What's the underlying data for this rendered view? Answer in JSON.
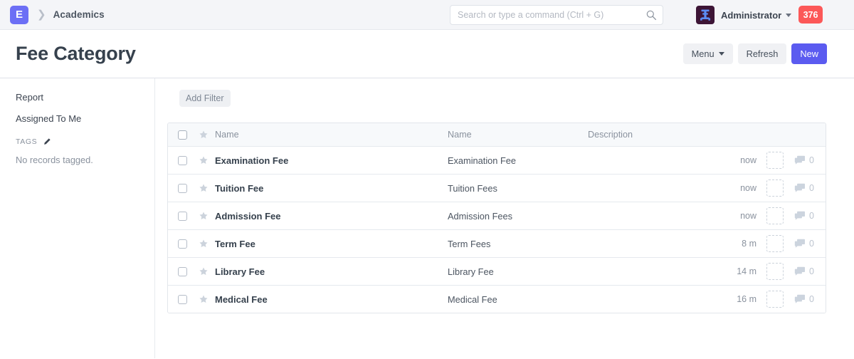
{
  "navbar": {
    "logo_letter": "E",
    "breadcrumb": "Academics",
    "separator_icon": "chevron-right-icon",
    "search": {
      "placeholder": "Search or type a command (Ctrl + G)",
      "value": "",
      "icon": "search-icon"
    },
    "user": {
      "name": "Administrator",
      "avatar_icon": "user-avatar-icon",
      "caret_icon": "chevron-down-icon"
    },
    "notification_badge": "376",
    "colors": {
      "logo_bg": "#6c6ff5",
      "badge_bg": "#fc5858",
      "navbar_bg": "#f4f5f8"
    }
  },
  "titlebar": {
    "title": "Fee Category",
    "buttons": {
      "menu": "Menu",
      "refresh": "Refresh",
      "new": "New"
    },
    "primary_color": "#5b5bf0"
  },
  "sidebar": {
    "links": [
      {
        "label": "Report"
      },
      {
        "label": "Assigned To Me"
      }
    ],
    "tags": {
      "heading": "TAGS",
      "edit_icon": "pencil-icon",
      "empty_text": "No records tagged."
    }
  },
  "content": {
    "filter": {
      "add_filter_label": "Add Filter"
    },
    "table": {
      "headers": {
        "select_all_icon": "checkbox-icon",
        "star_icon": "star-icon",
        "subject": "Name",
        "name": "Name",
        "description": "Description"
      },
      "rows": [
        {
          "subject": "Examination Fee",
          "name": "Examination Fee",
          "description": "",
          "modified": "now",
          "comments": "0"
        },
        {
          "subject": "Tuition Fee",
          "name": "Tuition Fees",
          "description": "",
          "modified": "now",
          "comments": "0"
        },
        {
          "subject": "Admission Fee",
          "name": "Admission Fees",
          "description": "",
          "modified": "now",
          "comments": "0"
        },
        {
          "subject": "Term Fee",
          "name": "Term Fees",
          "description": "",
          "modified": "8 m",
          "comments": "0"
        },
        {
          "subject": "Library Fee",
          "name": "Library Fee",
          "description": "",
          "modified": "14 m",
          "comments": "0"
        },
        {
          "subject": "Medical Fee",
          "name": "Medical Fee",
          "description": "",
          "modified": "16 m",
          "comments": "0"
        }
      ]
    }
  }
}
